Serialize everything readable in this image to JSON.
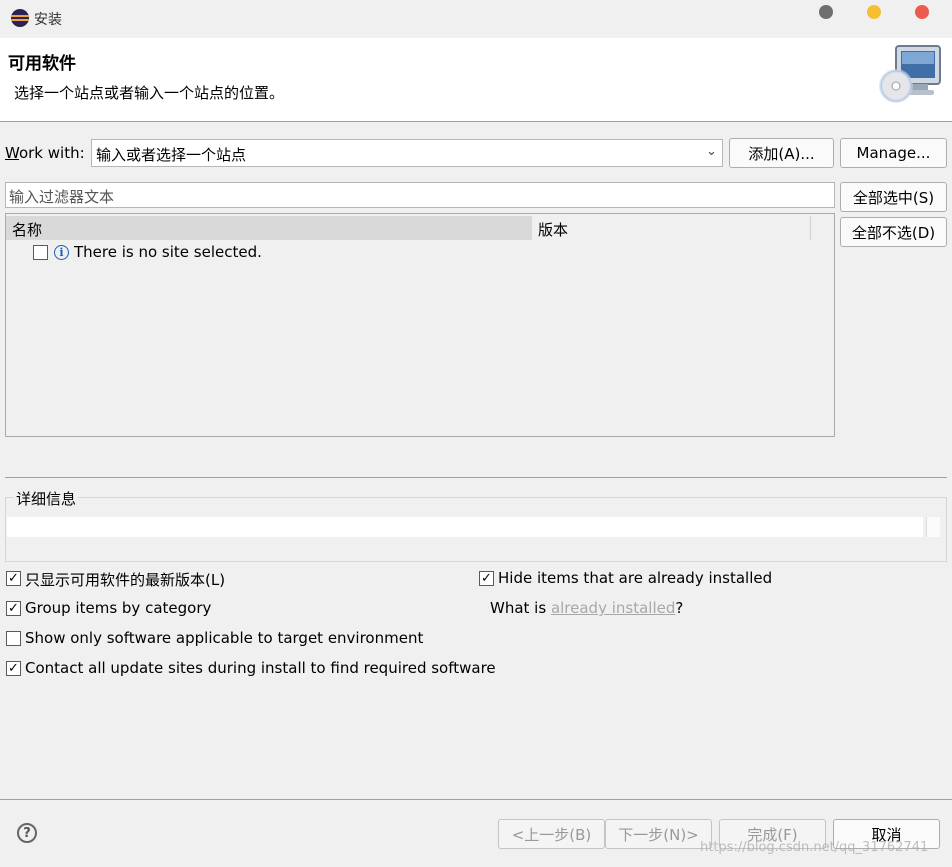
{
  "window": {
    "title": "安装"
  },
  "banner": {
    "title": "可用软件",
    "description": "选择一个站点或者输入一个站点的位置。",
    "icon": "computer-cd-icon"
  },
  "work_with": {
    "label": "Work with:",
    "value": "输入或者选择一个站点",
    "add_button": "添加(A)...",
    "manage_button": "Manage..."
  },
  "filter": {
    "placeholder": "输入过滤器文本"
  },
  "selection": {
    "select_all": "全部选中(S)",
    "deselect_all": "全部不选(D)"
  },
  "table": {
    "columns": [
      "名称",
      "版本"
    ],
    "rows": [
      {
        "name": "There is no site selected.",
        "checked": false,
        "icon": "info-icon"
      }
    ]
  },
  "details": {
    "label": "详细信息"
  },
  "options": {
    "show_latest": {
      "label": "只显示可用软件的最新版本(L)",
      "checked": true
    },
    "group_by_category": {
      "label": "Group items by category",
      "checked": true
    },
    "show_applicable": {
      "label": "Show only software applicable to target environment",
      "checked": false
    },
    "contact_sites": {
      "label": "Contact all update sites during install to find required software",
      "checked": true
    },
    "hide_installed": {
      "label": "Hide items that are already installed",
      "checked": true
    },
    "what_is": {
      "prefix": "What is ",
      "link": "already installed",
      "suffix": "?"
    }
  },
  "footer": {
    "back": "<上一步(B)",
    "next": "下一步(N)>",
    "finish": "完成(F)",
    "cancel": "取消",
    "watermark": "https://blog.csdn.net/qq_31762741"
  },
  "colors": {
    "traffic_close": "#ed5a4f",
    "traffic_min": "#f6be31",
    "traffic_dim": "#6e6e6e",
    "link": "#a8a8a8"
  }
}
